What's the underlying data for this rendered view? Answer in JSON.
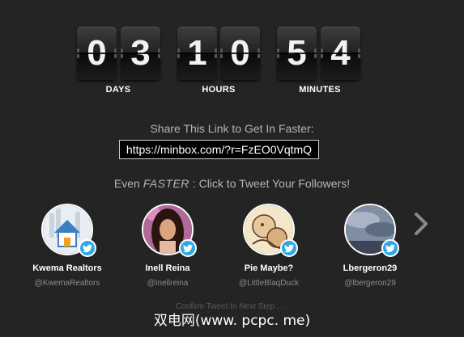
{
  "countdown": {
    "days": [
      "0",
      "3"
    ],
    "hours": [
      "1",
      "0"
    ],
    "minutes": [
      "5",
      "4"
    ],
    "labels": {
      "days": "DAYS",
      "hours": "HOURS",
      "minutes": "MINUTES"
    }
  },
  "share": {
    "heading": "Share This Link to Get In Faster:",
    "link": "https://minbox.com/?r=FzEO0VqtmQ"
  },
  "tweet": {
    "prefix": "Even ",
    "emphasis": "FASTER",
    "suffix": " : Click to Tweet Your Followers!"
  },
  "followers": [
    {
      "name": "Kwema Realtors",
      "handle": "@KwemaRealtors",
      "icon": "house-logo"
    },
    {
      "name": "Inell Reina",
      "handle": "@Inellreina",
      "icon": "person-photo"
    },
    {
      "name": "Pie Maybe?",
      "handle": "@LittleBlaqDuck",
      "icon": "illustration"
    },
    {
      "name": "Lbergeron29",
      "handle": "@lbergeron29",
      "icon": "sky-photo"
    }
  ],
  "next_icon": "chevron-right-icon",
  "confirm_text": "Confirm Tweet In Next Step . . .",
  "watermark": "双电网(www. pcpc. me)",
  "colors": {
    "background": "#242424",
    "twitter": "#2ea9e6",
    "muted": "#b5b5b5"
  }
}
